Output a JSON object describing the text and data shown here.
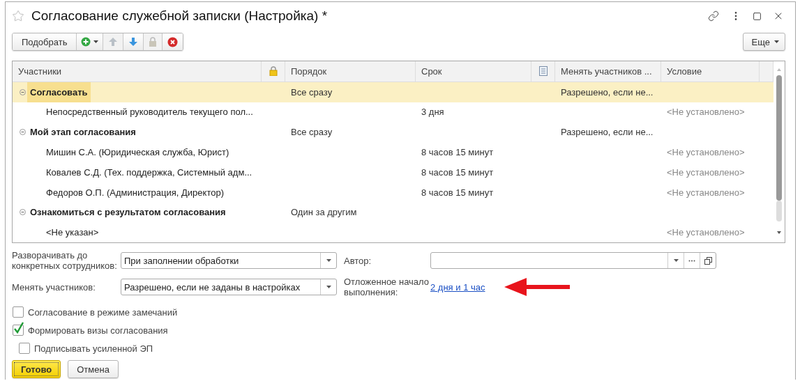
{
  "window": {
    "title": "Согласование служебной записки (Настройка) *"
  },
  "toolbar": {
    "pick_button": "Подобрать",
    "more_button": "Еще"
  },
  "table": {
    "columns": [
      {
        "kind": "text",
        "label": "Участники"
      },
      {
        "kind": "lock"
      },
      {
        "kind": "text",
        "label": "Порядок"
      },
      {
        "kind": "text",
        "label": "Срок"
      },
      {
        "kind": "note"
      },
      {
        "kind": "text",
        "label": "Менять участников ..."
      },
      {
        "kind": "text",
        "label": "Условие"
      }
    ],
    "rows": [
      {
        "kind": "group",
        "expanded": true,
        "selected": true,
        "participant": "Согласовать",
        "order": "Все сразу",
        "change": "Разрешено, если не..."
      },
      {
        "kind": "item",
        "selected": false,
        "participant": "Непосредственный руководитель текущего пол...",
        "term": "3 дня",
        "condition": "<Не установлено>"
      },
      {
        "kind": "group",
        "expanded": true,
        "selected": false,
        "participant": "Мой этап согласования",
        "order": "Все сразу",
        "change": "Разрешено, если не..."
      },
      {
        "kind": "item",
        "selected": false,
        "participant": "Мишин С.А. (Юридическая служба, Юрист)",
        "term": "8 часов 15 минут",
        "condition": "<Не установлено>"
      },
      {
        "kind": "item",
        "selected": false,
        "participant": "Ковалев С.Д. (Тех. поддержка, Системный адм...",
        "term": "8 часов 15 минут",
        "condition": "<Не установлено>"
      },
      {
        "kind": "item",
        "selected": false,
        "participant": "Федоров О.П. (Администрация, Директор)",
        "term": "8 часов 15 минут",
        "condition": "<Не установлено>"
      },
      {
        "kind": "group",
        "expanded": true,
        "selected": false,
        "participant": "Ознакомиться с результатом согласования",
        "order": "Один за другим"
      },
      {
        "kind": "item",
        "selected": false,
        "participant": "<Не указан>",
        "condition": "<Не установлено>"
      }
    ]
  },
  "form": {
    "expand_to": {
      "label": "Разворачивать до конкретных сотрудников:",
      "value": "При заполнении обработки"
    },
    "author": {
      "label": "Автор:"
    },
    "change_participants": {
      "label": "Менять участников:",
      "value": "Разрешено, если не заданы в настройках"
    },
    "deferred_start": {
      "label": "Отложенное начало выполнения:",
      "link": "2 дня и 1 час"
    },
    "checkboxes": [
      {
        "label": "Согласование в режиме замечаний",
        "checked": false
      },
      {
        "label": "Формировать визы согласования",
        "checked": true,
        "children": [
          {
            "label": "Подписывать усиленной ЭП",
            "checked": false
          }
        ]
      }
    ]
  },
  "buttons": [
    {
      "kind": "primary",
      "label": "Готово"
    },
    {
      "kind": "default",
      "label": "Отмена"
    }
  ]
}
